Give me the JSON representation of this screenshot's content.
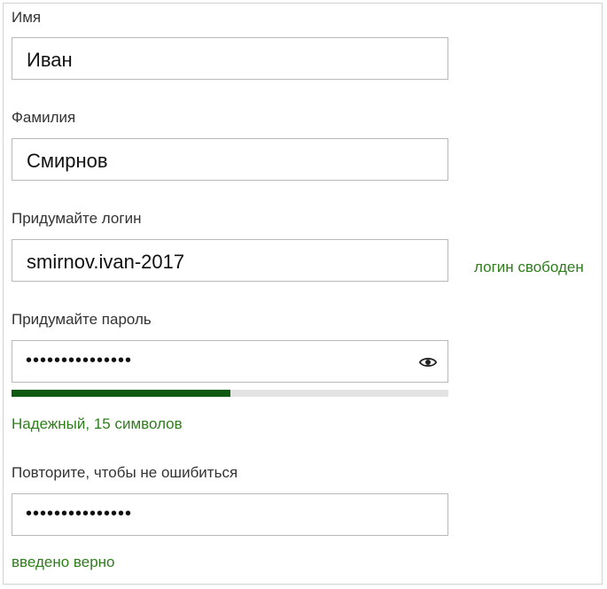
{
  "form": {
    "first_name": {
      "label": "Имя",
      "value": "Иван"
    },
    "last_name": {
      "label": "Фамилия",
      "value": "Смирнов"
    },
    "login": {
      "label": "Придумайте логин",
      "value": "smirnov.ivan-2017",
      "status": "логин свободен"
    },
    "password": {
      "label": "Придумайте пароль",
      "masked": "•••••••••••••••",
      "toggle_icon": "eye-icon",
      "strength_text": "Надежный, 15 символов",
      "strength_level": 0.5
    },
    "password_repeat": {
      "label": "Повторите, чтобы не ошибиться",
      "masked": "•••••••••••••••",
      "status": "введено верно"
    }
  },
  "colors": {
    "success_text": "#2f7d1c",
    "strength_fill": "#0f5a12",
    "strength_track": "#e3e3e3",
    "field_border": "#b9b9b9"
  }
}
